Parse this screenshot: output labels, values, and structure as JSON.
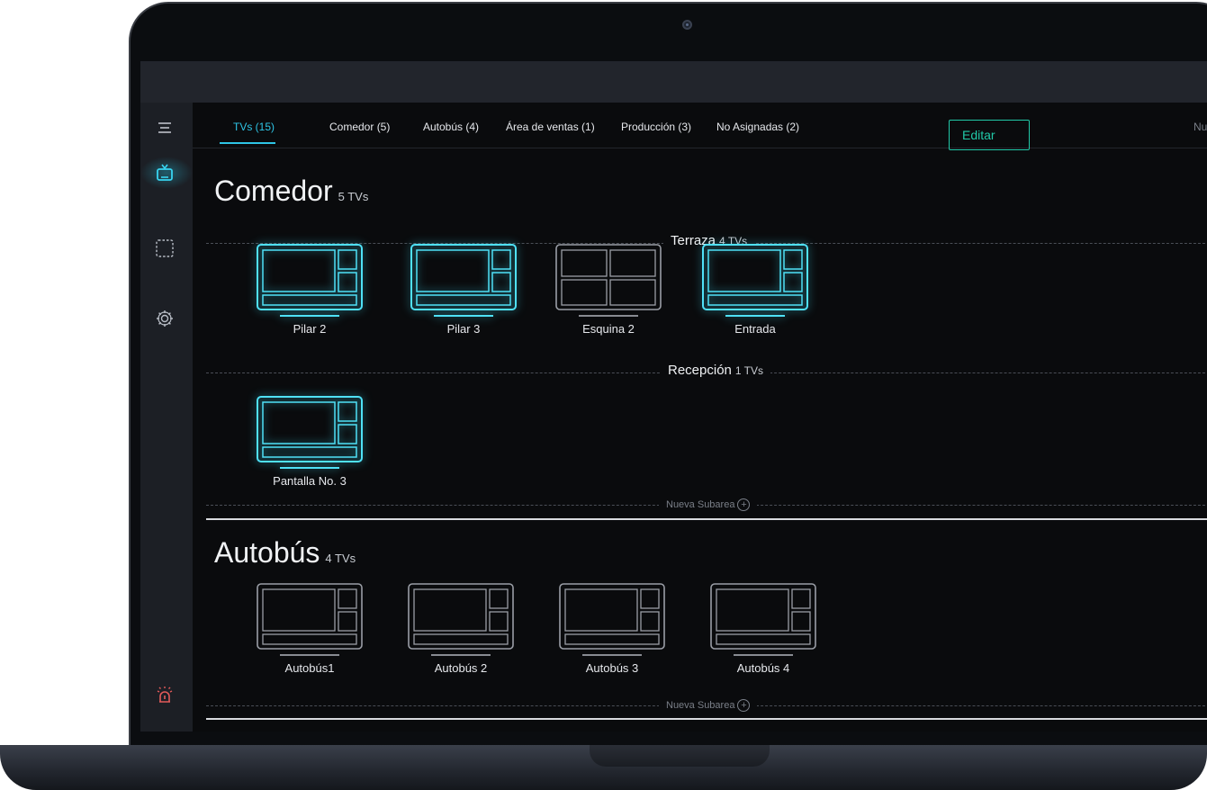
{
  "tabs": [
    {
      "label": "TVs (15)",
      "active": true
    },
    {
      "label": "Comedor (5)"
    },
    {
      "label": "Autobús (4)"
    },
    {
      "label": "Área de ventas (1)"
    },
    {
      "label": "Producción (3)"
    },
    {
      "label": "No Asignadas (2)"
    }
  ],
  "tab_overflow": "Nu",
  "edit_label": "Editar",
  "colors": {
    "accent": "#2ec5e6",
    "edit": "#21c9a8",
    "inactive_tv": "#9a9ea6"
  },
  "sidebar": {
    "icons": [
      "menu-icon",
      "tv-icon",
      "selection-icon",
      "gear-icon",
      "alarm-icon"
    ]
  },
  "areas": [
    {
      "name": "Comedor",
      "count": "5 TVs",
      "subareas": [
        {
          "name": "Terraza",
          "count": "4 TVs",
          "tvs": [
            {
              "label": "Pilar 2",
              "active": true,
              "layout": "split"
            },
            {
              "label": "Pilar 3",
              "active": true,
              "layout": "split"
            },
            {
              "label": "Esquina 2",
              "active": false,
              "layout": "quad"
            },
            {
              "label": "Entrada",
              "active": true,
              "layout": "split"
            }
          ]
        },
        {
          "name": "Recepción",
          "count": "1 TVs",
          "tvs": [
            {
              "label": "Pantalla No. 3",
              "active": true,
              "layout": "split"
            }
          ]
        }
      ],
      "new_subarea": "Nueva Subarea"
    },
    {
      "name": "Autobús",
      "count": "4 TVs",
      "tvs": [
        {
          "label": "Autobús1",
          "active": false,
          "layout": "split"
        },
        {
          "label": "Autobús 2",
          "active": false,
          "layout": "split"
        },
        {
          "label": "Autobús 3",
          "active": false,
          "layout": "split"
        },
        {
          "label": "Autobús 4",
          "active": false,
          "layout": "split"
        }
      ],
      "new_subarea": "Nueva Subarea"
    }
  ]
}
